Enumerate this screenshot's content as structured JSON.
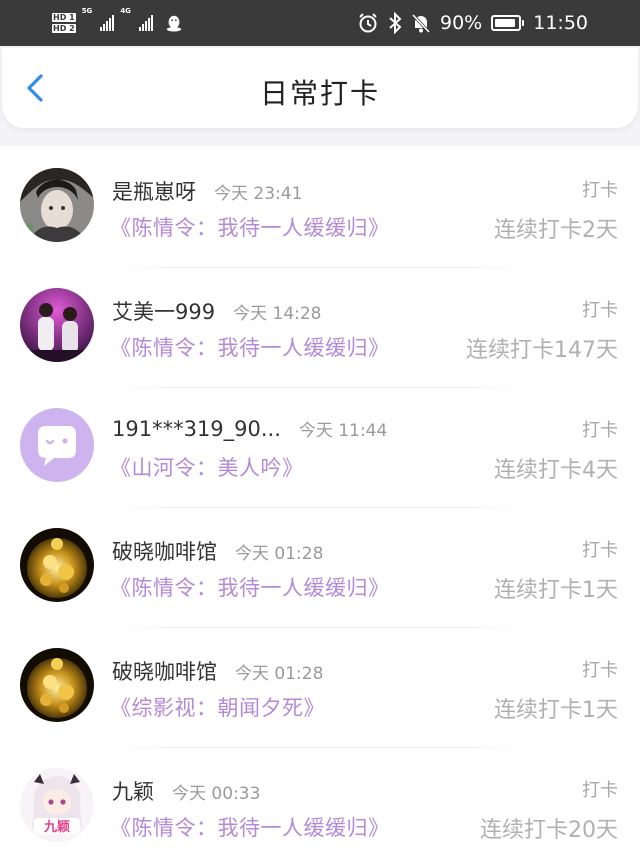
{
  "status_bar": {
    "hd1": "HD 1",
    "hd2": "HD 2",
    "net1": "5G",
    "net2": "4G",
    "battery_text": "90%",
    "battery_level": 0.9,
    "time": "11:50",
    "icons": [
      "alarm-icon",
      "bluetooth-icon",
      "mute-bell-icon",
      "battery-icon"
    ]
  },
  "header": {
    "title": "日常打卡",
    "back_icon": "chevron-left-icon",
    "accent": "#2f8fe6"
  },
  "colors": {
    "book_title": "#b48ad6",
    "meta": "#9a9a9a",
    "streak": "#b0b0b0"
  },
  "items": [
    {
      "name": "是瓶崽呀",
      "time": "今天 23:41",
      "book": "《陈情令：我待一人缓缓归》",
      "label": "打卡",
      "streak": "连续打卡2天",
      "avatar": "anime-portrait"
    },
    {
      "name": "艾美一999",
      "time": "今天 14:28",
      "book": "《陈情令：我待一人缓缓归》",
      "label": "打卡",
      "streak": "连续打卡147天",
      "avatar": "stage-photo"
    },
    {
      "name": "191***319_90...",
      "time": "今天 11:44",
      "book": "《山河令：美人吟》",
      "label": "打卡",
      "streak": "连续打卡4天",
      "avatar": "default-chat-avatar"
    },
    {
      "name": "破晓咖啡馆",
      "time": "今天 01:28",
      "book": "《陈情令：我待一人缓缓归》",
      "label": "打卡",
      "streak": "连续打卡1天",
      "avatar": "gold-coins"
    },
    {
      "name": "破晓咖啡馆",
      "time": "今天 01:28",
      "book": "《综影视：朝闻夕死》",
      "label": "打卡",
      "streak": "连续打卡1天",
      "avatar": "gold-coins"
    },
    {
      "name": "九颖",
      "time": "今天 00:33",
      "book": "《陈情令：我待一人缓缓归》",
      "label": "打卡",
      "streak": "连续打卡20天",
      "avatar": "chibi-girl"
    }
  ]
}
